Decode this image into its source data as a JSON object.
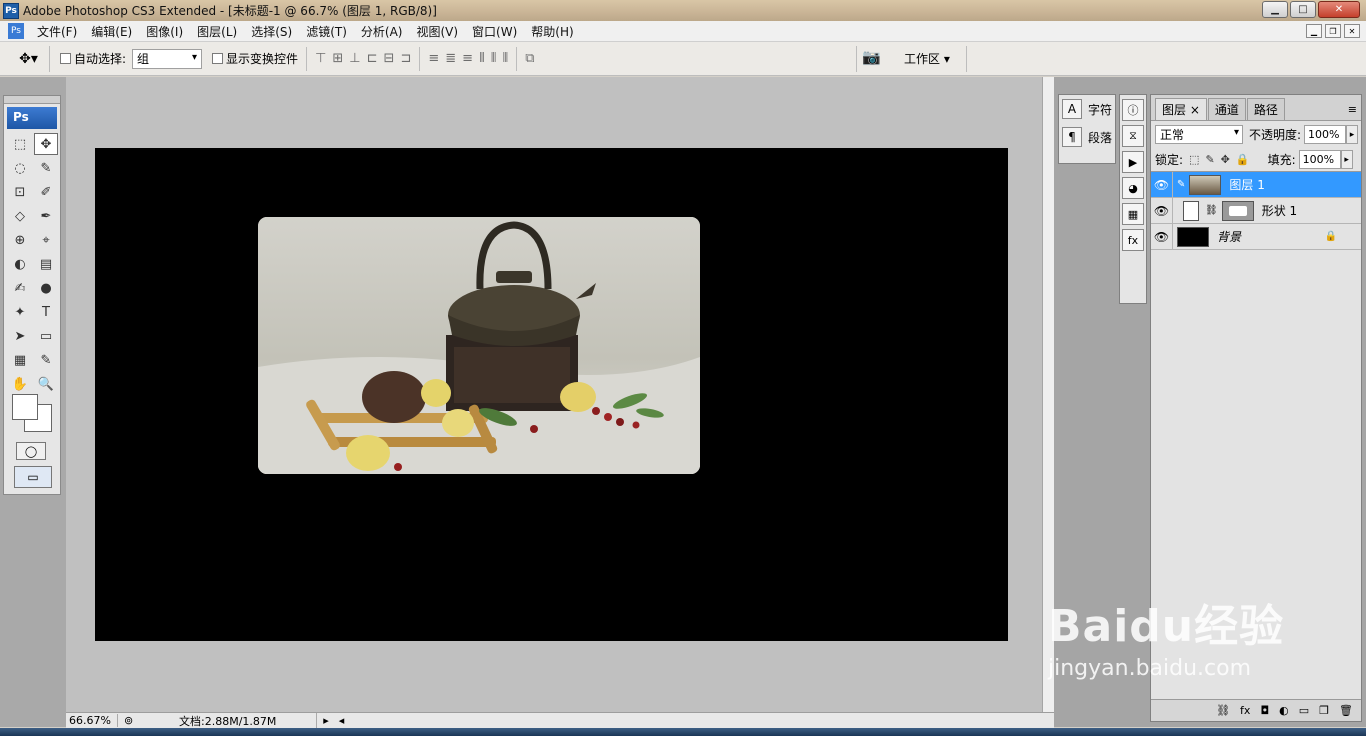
{
  "window": {
    "app_icon_label": "Ps",
    "title": "Adobe Photoshop CS3 Extended - [未标题-1 @ 66.7% (图层 1, RGB/8)]",
    "buttons": {
      "minimize": "▁",
      "maximize": "□",
      "close": "✕"
    }
  },
  "menubar": {
    "icon_label": "Ps",
    "items": [
      "文件(F)",
      "编辑(E)",
      "图像(I)",
      "图层(L)",
      "选择(S)",
      "滤镜(T)",
      "分析(A)",
      "视图(V)",
      "窗口(W)",
      "帮助(H)"
    ]
  },
  "options": {
    "tool_icon": "move-tool-icon",
    "auto_select_label": "自动选择:",
    "auto_select_value": "组",
    "show_transform_label": "显示变换控件",
    "workspace_label": "工作区 ▾"
  },
  "toolbox": {
    "logo": "Ps",
    "tools": [
      "⬚",
      "✥",
      "◌",
      "✎",
      "⊡",
      "✐",
      "◇",
      "✒",
      "⊕",
      "⌖",
      "◐",
      "▤",
      "✍",
      "●",
      "✦",
      "T",
      "➤",
      "▭",
      "▦",
      "✎",
      "✋",
      "🔍"
    ]
  },
  "canvas": {
    "background_color": "#000000",
    "photo_description": ""
  },
  "status": {
    "zoom": "66.67%",
    "doc_info": "文档:2.88M/1.87M"
  },
  "char_panel": {
    "items": [
      {
        "icon": "A",
        "label": "字符"
      },
      {
        "icon": "¶",
        "label": "段落"
      }
    ]
  },
  "layers_panel": {
    "tabs": [
      "图层 ×",
      "通道",
      "路径"
    ],
    "blend_mode": "正常",
    "opacity_label": "不透明度:",
    "opacity_value": "100%",
    "lock_label": "锁定:",
    "fill_label": "填充:",
    "fill_value": "100%",
    "layers": [
      {
        "name": "图层 1",
        "selected": true
      },
      {
        "name": "形状 1",
        "selected": false
      },
      {
        "name": "背景",
        "selected": false
      }
    ]
  },
  "watermark": {
    "brand": "Baidu经验",
    "url": "jingyan.baidu.com"
  }
}
